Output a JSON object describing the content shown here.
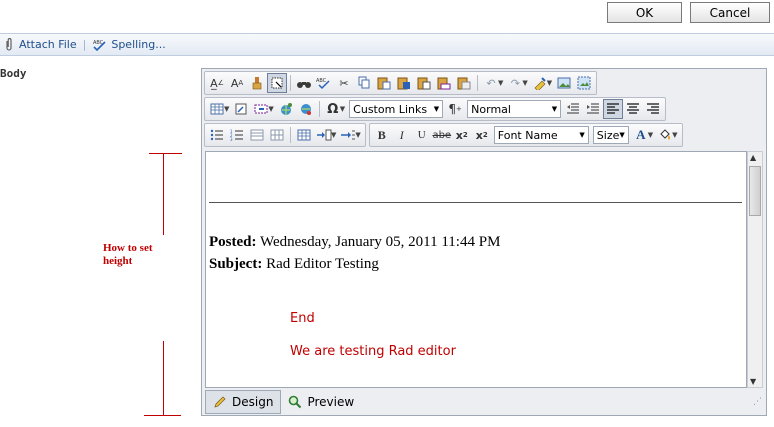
{
  "dialog": {
    "ok_label": "OK",
    "cancel_label": "Cancel"
  },
  "toolbar": {
    "attach_label": "Attach File",
    "spelling_label": "Spelling..."
  },
  "field": {
    "body_label": "Body"
  },
  "editor": {
    "custom_links": "Custom Links",
    "paragraph_style": "Normal",
    "font_name": "Font Name",
    "font_size": "Size",
    "modes": {
      "design": "Design",
      "preview": "Preview"
    },
    "content": {
      "posted_label": "Posted:",
      "posted_value": "Wednesday, January 05, 2011 11:44 PM",
      "subject_label": "Subject:",
      "subject_value": "Rad Editor Testing",
      "line_end": "End",
      "line_testing": "We are testing Rad editor"
    }
  },
  "annotation": {
    "text": "How to set height"
  },
  "colors": {
    "annotation": "#c00000",
    "editor_text_red": "#c00000",
    "link_blue": "#1e4e8a"
  }
}
